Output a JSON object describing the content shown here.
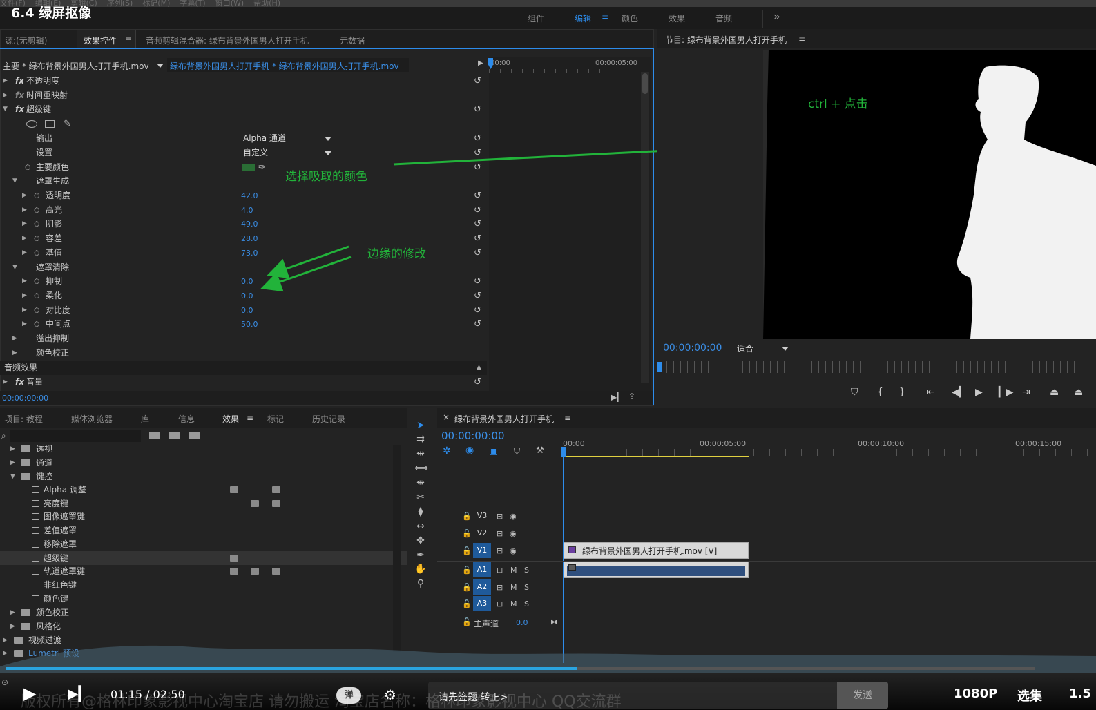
{
  "menu": [
    "文件(F)",
    "编辑(E)",
    "剪辑(C)",
    "序列(S)",
    "标记(M)",
    "字幕(T)",
    "窗口(W)",
    "帮助(H)"
  ],
  "video_title": "6.4 绿屏抠像",
  "workspaces": [
    "组件",
    "编辑",
    "颜色",
    "效果",
    "音频"
  ],
  "active_workspace": "编辑",
  "more_label": "»",
  "source_panel": {
    "tabs": [
      "源:(无剪辑)",
      "效果控件",
      "音频剪辑混合器: 绿布背景外国男人打开手机",
      "元数据"
    ],
    "header_left": "主要 * 绿布背景外国男人打开手机.mov",
    "header_right": "绿布背景外国男人打开手机 * 绿布背景外国男人打开手机.mov",
    "ruler": {
      "start": "00:00",
      "mid": "00:00:05:00"
    },
    "timecode": "00:00:00:00",
    "rows": {
      "opacity": "不透明度",
      "timeremap": "时间重映射",
      "ultrakey": "超级键",
      "output_label": "输出",
      "output_value": "Alpha 通道",
      "setting_label": "设置",
      "setting_value": "自定义",
      "keycolor_label": "主要颜色",
      "matte_gen": "遮罩生成",
      "transparency": "透明度",
      "transparency_v": "42.0",
      "highlight": "高光",
      "highlight_v": "4.0",
      "shadow": "阴影",
      "shadow_v": "49.0",
      "tolerance": "容差",
      "tolerance_v": "28.0",
      "pedestal": "基值",
      "pedestal_v": "73.0",
      "matte_cleanup": "遮罩清除",
      "choke": "抑制",
      "choke_v": "0.0",
      "soften": "柔化",
      "soften_v": "0.0",
      "contrast": "对比度",
      "contrast_v": "0.0",
      "midpoint": "中间点",
      "midpoint_v": "50.0",
      "spill": "溢出抑制",
      "colorcorr": "颜色校正",
      "audio_effects": "音频效果",
      "volume": "音量"
    },
    "key_color": "#2a6e35"
  },
  "program_panel": {
    "title": "节目: 绿布背景外国男人打开手机",
    "timecode": "00:00:00:00",
    "fit_label": "适合"
  },
  "annotations": {
    "pick_color": "选择吸取的颜色",
    "edge": "边缘的修改",
    "ctrl_click": "ctrl + 点击"
  },
  "project_panel": {
    "tabs": [
      "项目: 教程",
      "媒体浏览器",
      "库",
      "信息",
      "效果",
      "标记",
      "历史记录"
    ],
    "items": [
      "透视",
      "通道",
      "键控",
      "Alpha 调整",
      "亮度键",
      "图像遮罩键",
      "差值遮罩",
      "移除遮罩",
      "超级键",
      "轨道遮罩键",
      "非红色键",
      "颜色键",
      "颜色校正",
      "风格化",
      "视频过渡",
      "Lumetri 预设"
    ]
  },
  "timeline": {
    "title": "绿布背景外国男人打开手机",
    "timecode": "00:00:00:00",
    "ruler": [
      "00:00",
      "00:00:05:00",
      "00:00:10:00",
      "00:00:15:00"
    ],
    "tracks": {
      "v3": "V3",
      "v2": "V2",
      "v1": "V1",
      "a1": "A1",
      "a2": "A2",
      "a3": "A3",
      "master": "主声道",
      "master_v": "0.0"
    },
    "clip_label": "绿布背景外国男人打开手机.mov [V]",
    "m": "M",
    "s": "S"
  },
  "player": {
    "time": "01:15 / 02:50",
    "danmu_btn": "弹",
    "input_placeholder": "请先签题 转正>",
    "send": "发送",
    "quality": "1080P",
    "select": "选集",
    "speed": "1.5",
    "overlay_text": "版权所有@格林印象影视中心淘宝店 请勿搬运 淘宝店名称：格林印象影视中心 QQ交流群"
  }
}
